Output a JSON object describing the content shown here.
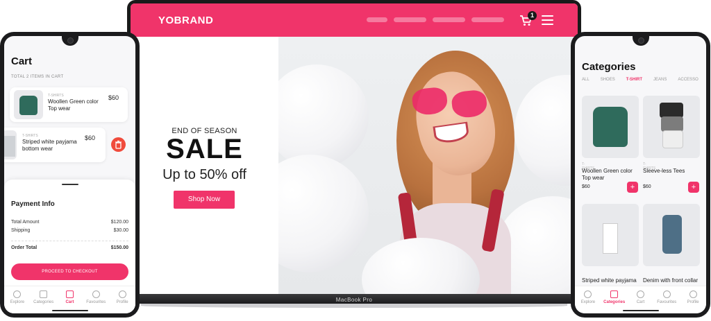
{
  "laptop": {
    "brand": "YOBRAND",
    "cart_count": "1",
    "hero": {
      "eyebrow": "END OF SEASON",
      "title": "SALE",
      "subtitle": "Up to 50% off",
      "cta": "Shop Now"
    },
    "model_label": "MacBook Pro"
  },
  "cart_phone": {
    "title": "Cart",
    "subtitle": "TOTAL 2 ITEMS IN CART",
    "items": [
      {
        "category": "T-SHIRTS",
        "name": "Woollen Green color Top wear",
        "price": "$60"
      },
      {
        "category": "T-SHIRTS",
        "name": "Striped white payjama bottom wear",
        "price": "$60"
      }
    ],
    "payment": {
      "title": "Payment Info",
      "total_label": "Total Amount",
      "total_value": "$120.00",
      "shipping_label": "Shipping",
      "shipping_value": "$30.00",
      "order_label": "Order Total",
      "order_value": "$150.00",
      "checkout": "PROCEED TO CHECKOUT"
    },
    "tabs": [
      "Explore",
      "Categories",
      "Cart",
      "Favourites",
      "Profile"
    ],
    "active_tab": "Cart"
  },
  "categories_phone": {
    "title": "Categories",
    "filters": [
      "ALL",
      "SHOES",
      "T-SHIRT",
      "JEANS",
      "ACCESSO"
    ],
    "active_filter": "T-SHIRT",
    "products": [
      {
        "category": "T-SHIRTS",
        "name": "Woollen Green color Top wear",
        "price": "$60"
      },
      {
        "category": "T-SHIRTS",
        "name": "Sleeve-less Tees",
        "price": "$60"
      },
      {
        "category": "",
        "name": "Striped white payjama",
        "price": ""
      },
      {
        "category": "",
        "name": "Denim with front collar",
        "price": ""
      }
    ],
    "add_symbol": "+",
    "tabs": [
      "Explore",
      "Categories",
      "Cart",
      "Favourites",
      "Profile"
    ],
    "active_tab": "Categories"
  },
  "colors": {
    "accent": "#f0346a",
    "delete": "#f04b3c"
  }
}
